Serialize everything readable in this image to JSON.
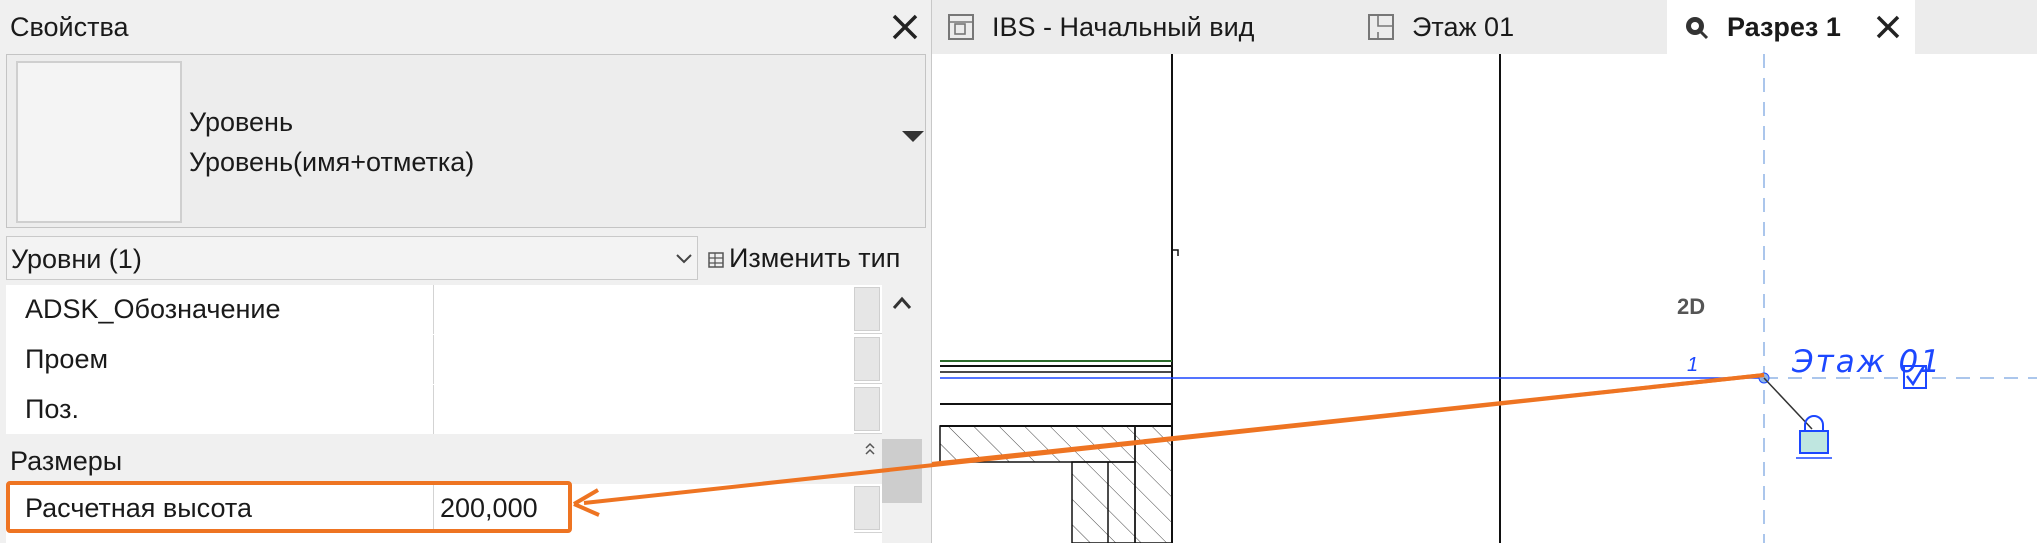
{
  "properties_panel": {
    "title": "Свойства",
    "type_selector": {
      "family": "Уровень",
      "type": "Уровень(имя+отметка)"
    },
    "filter": {
      "label": "Уровни (1)",
      "edit_type_label": "Изменить тип"
    },
    "rows": [
      {
        "name": "ADSK_Обозначение",
        "value": ""
      },
      {
        "name": "Проем",
        "value": ""
      },
      {
        "name": "Поз.",
        "value": ""
      }
    ],
    "group": {
      "label": "Размеры",
      "rows": [
        {
          "name": "Расчетная высота",
          "value": "200,000"
        }
      ]
    }
  },
  "tabs": [
    {
      "label": "IBS - Начальный вид",
      "icon": "3d-view-icon",
      "active": false
    },
    {
      "label": "Этаж 01",
      "icon": "floor-plan-icon",
      "active": false
    },
    {
      "label": "Разрез 1",
      "icon": "section-view-icon",
      "active": true
    }
  ],
  "drawing": {
    "view_mode": "2D",
    "level_name": "Этаж 01",
    "level_mark": "1"
  },
  "colors": {
    "accent": "#EE7422",
    "level": "#1C47FF",
    "panel_bg": "#F0F0F0"
  }
}
